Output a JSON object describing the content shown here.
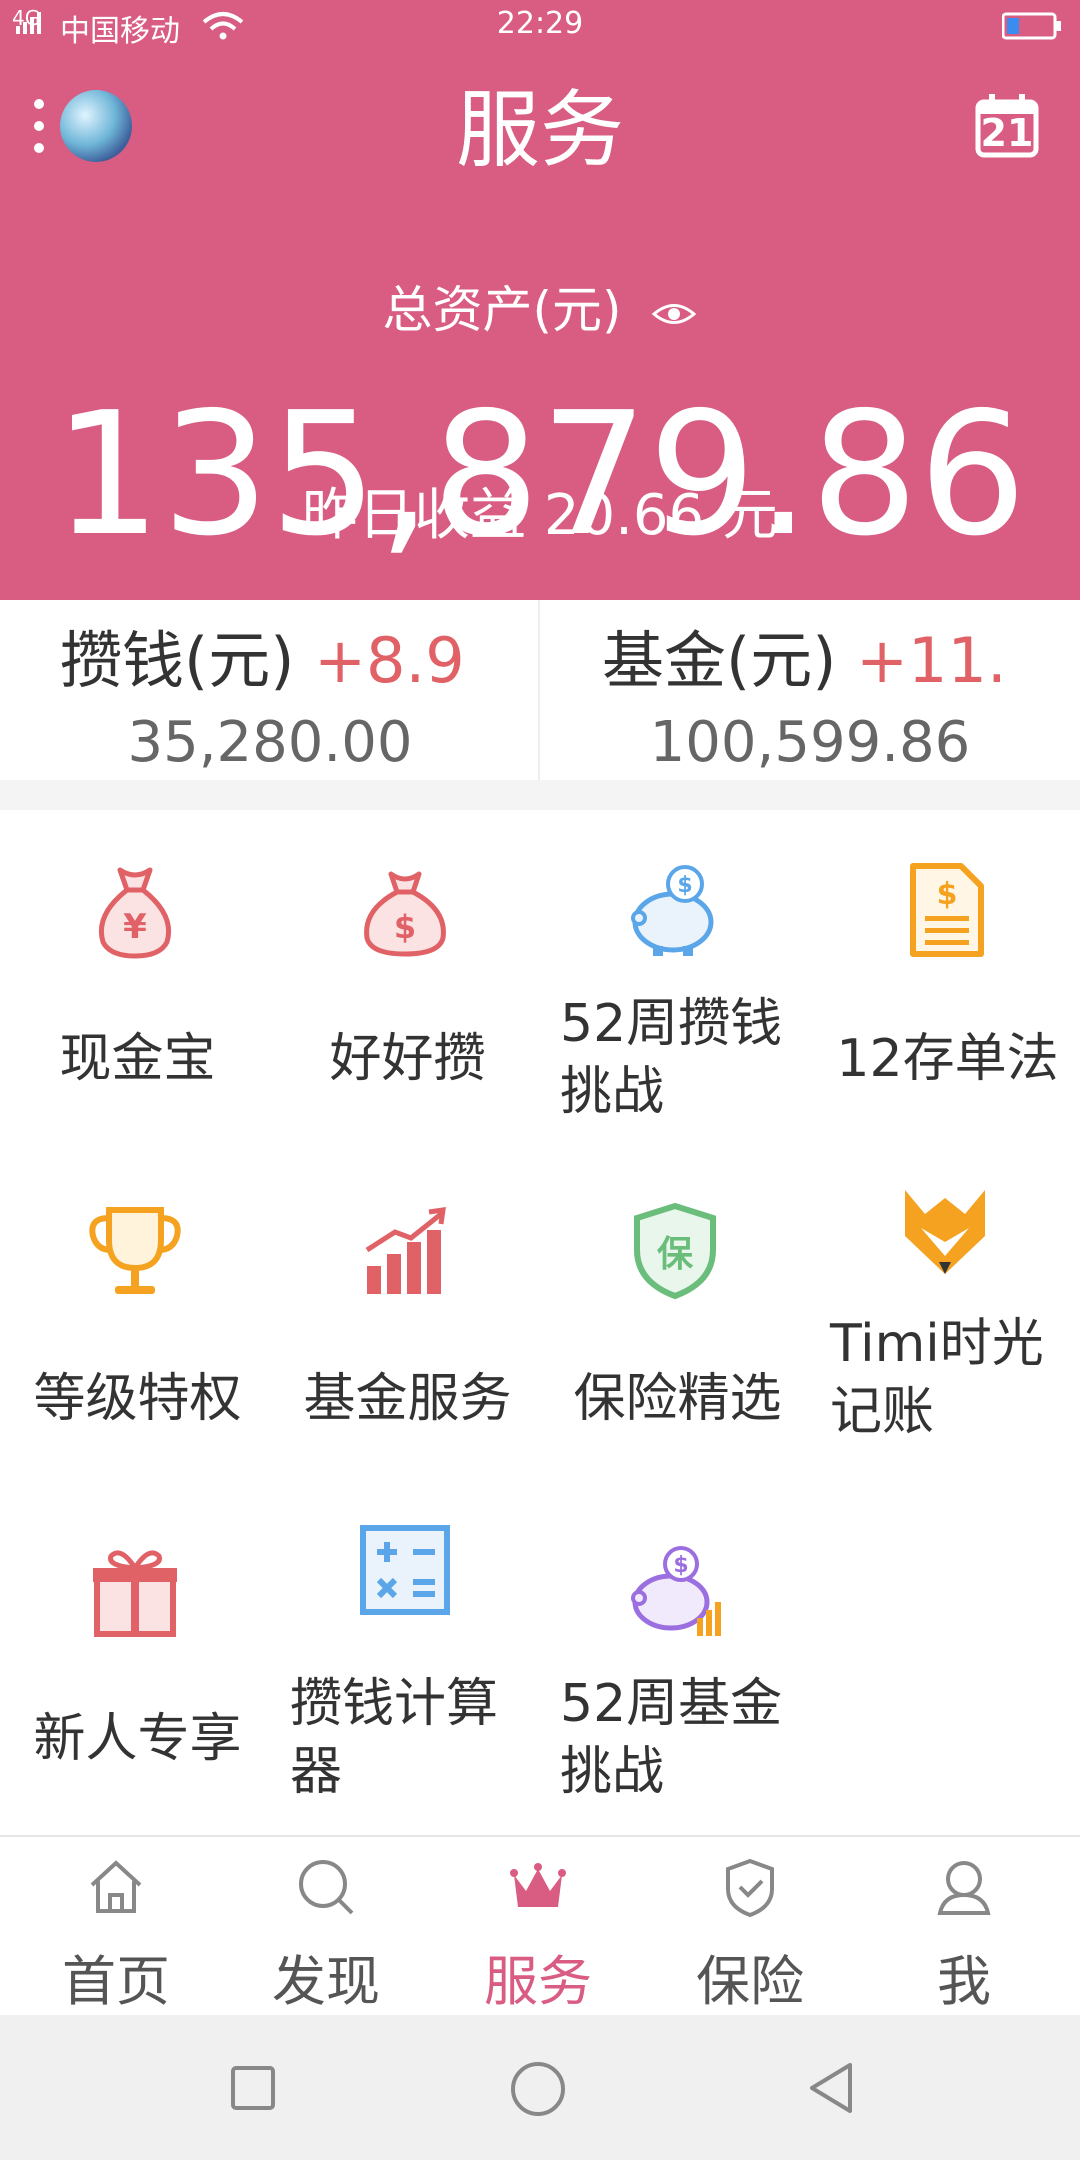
{
  "status_bar": {
    "carrier": "中国移动",
    "network": "4G",
    "time": "22:29"
  },
  "header": {
    "title": "服务",
    "calendar_day": "21",
    "total_assets_label": "总资产(元)",
    "total_assets_value": "135,879.86",
    "yesterday_earnings": "昨日收益 20.66 元"
  },
  "summary": [
    {
      "label": "攒钱(元)",
      "delta": "+8.9",
      "value": "35,280.00"
    },
    {
      "label": "基金(元)",
      "delta": "+11.",
      "value": "100,599.86"
    }
  ],
  "grid": [
    {
      "label": "现金宝",
      "icon": "money-bag-yen-icon"
    },
    {
      "label": "好好攒",
      "icon": "money-bag-dollar-icon"
    },
    {
      "label": "52周攒钱挑战",
      "line1": "52周攒钱",
      "line2": "挑战",
      "icon": "piggy-bank-icon"
    },
    {
      "label": "12存单法",
      "icon": "document-dollar-icon"
    },
    {
      "label": "等级特权",
      "icon": "trophy-icon"
    },
    {
      "label": "基金服务",
      "icon": "chart-growth-icon"
    },
    {
      "label": "保险精选",
      "icon": "insurance-shield-icon"
    },
    {
      "label": "Timi时光记账",
      "line1": "Timi时光",
      "line2": "记账",
      "icon": "fox-logo-icon"
    },
    {
      "label": "新人专享",
      "icon": "gift-icon"
    },
    {
      "label": "攒钱计算器",
      "line1": "攒钱计算",
      "line2": "器",
      "icon": "calculator-icon"
    },
    {
      "label": "52周基金挑战",
      "line1": "52周基金",
      "line2": "挑战",
      "icon": "piggy-chart-icon"
    }
  ],
  "tabs": [
    {
      "label": "首页",
      "icon": "home-icon"
    },
    {
      "label": "发现",
      "icon": "search-icon"
    },
    {
      "label": "服务",
      "icon": "crown-icon",
      "active": true
    },
    {
      "label": "保险",
      "icon": "shield-check-icon"
    },
    {
      "label": "我",
      "icon": "user-icon"
    }
  ],
  "colors": {
    "brand": "#d95c82",
    "delta": "#e06266",
    "text": "#333333"
  }
}
